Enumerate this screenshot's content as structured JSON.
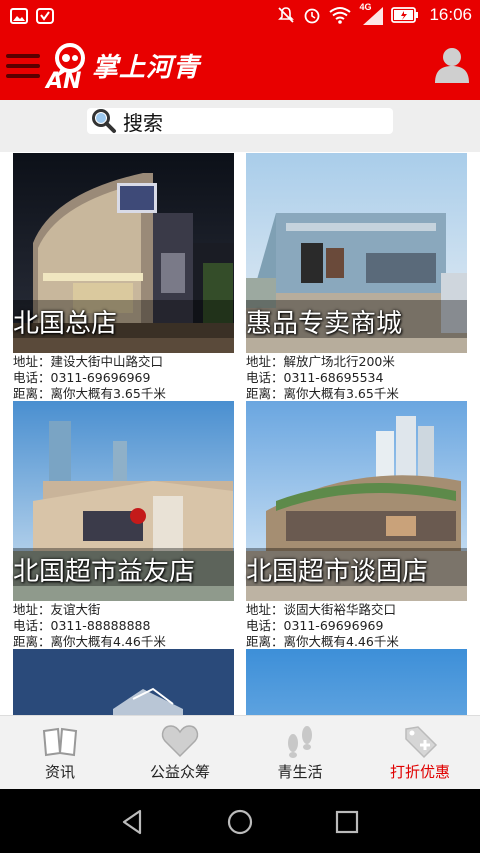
{
  "status_bar": {
    "time": "16:06",
    "network_label": "4G",
    "icons": [
      "image-notification-icon",
      "shield-notification-icon",
      "mute-icon",
      "alarm-icon",
      "wifi-icon",
      "signal-icon",
      "battery-icon"
    ]
  },
  "header": {
    "app_title": "掌上河青",
    "logo_letters": "AN",
    "menu_icon": "hamburger-menu-icon",
    "user_icon": "user-profile-icon"
  },
  "search": {
    "placeholder": "搜索"
  },
  "stores": [
    {
      "name": "北国总店",
      "address": "地址：建设大街中山路交口",
      "phone": "电话：0311-69696969",
      "distance": "距离：离你大概有3.65千米"
    },
    {
      "name": "惠品专卖商城",
      "address": "地址：解放广场北行200米",
      "phone": "电话：0311-68695534",
      "distance": "距离：离你大概有3.65千米"
    },
    {
      "name": "北国超市益友店",
      "address": "地址：友谊大街",
      "phone": "电话：0311-88888888",
      "distance": "距离：离你大概有4.46千米"
    },
    {
      "name": "北国超市谈固店",
      "address": "地址：谈固大街裕华路交口",
      "phone": "电话：0311-69696969",
      "distance": "距离：离你大概有4.46千米"
    }
  ],
  "tabs": [
    {
      "label": "资讯",
      "icon": "book-icon"
    },
    {
      "label": "公益众筹",
      "icon": "heart-icon"
    },
    {
      "label": "青生活",
      "icon": "footprints-icon"
    },
    {
      "label": "打折优惠",
      "icon": "price-tag-icon"
    }
  ],
  "active_tab": "打折优惠",
  "colors": {
    "brand_red": "#e80000",
    "active_tab": "#e00000",
    "tab_bar_bg": "#f2f2f2"
  }
}
